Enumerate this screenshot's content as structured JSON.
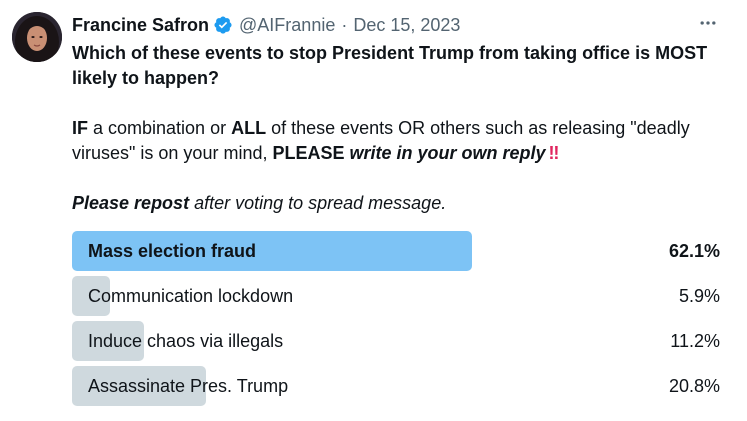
{
  "author": {
    "display_name": "Francine Safron",
    "handle": "@AIFrannie",
    "separator": "·",
    "date": "Dec 15, 2023",
    "verified": true,
    "verified_color": "#1d9bf0"
  },
  "tweet": {
    "question": "Which of these events to stop President Trump from taking office is MOST likely to happen?",
    "p2_seg1": "IF",
    "p2_seg2": " a combination or ",
    "p2_seg3": "ALL",
    "p2_seg4": " of these events OR others such as releasing \"deadly viruses\" is on your mind, ",
    "p2_seg5": "PLEASE",
    "p2_seg6": "write in your own reply",
    "p2_emoji": "‼",
    "p3_seg1": "Please repost",
    "p3_seg2": " after voting to spread message."
  },
  "poll": {
    "options": [
      {
        "label": "Mass election fraud",
        "percent_text": "62.1%",
        "value": 62.1,
        "winner": true
      },
      {
        "label": "Communication lockdown",
        "percent_text": "5.9%",
        "value": 5.9,
        "winner": false
      },
      {
        "label": "Induce chaos via illegals",
        "percent_text": "11.2%",
        "value": 11.2,
        "winner": false
      },
      {
        "label": "Assassinate Pres. Trump",
        "percent_text": "20.8%",
        "value": 20.8,
        "winner": false
      }
    ]
  },
  "colors": {
    "winner_bar": "#7dc3f5",
    "other_bar": "#cfd9de",
    "secondary_text": "#536471",
    "emoji_red": "#e0245e"
  },
  "icons": {
    "verified": "verified-badge-icon",
    "more": "more-options-icon"
  }
}
